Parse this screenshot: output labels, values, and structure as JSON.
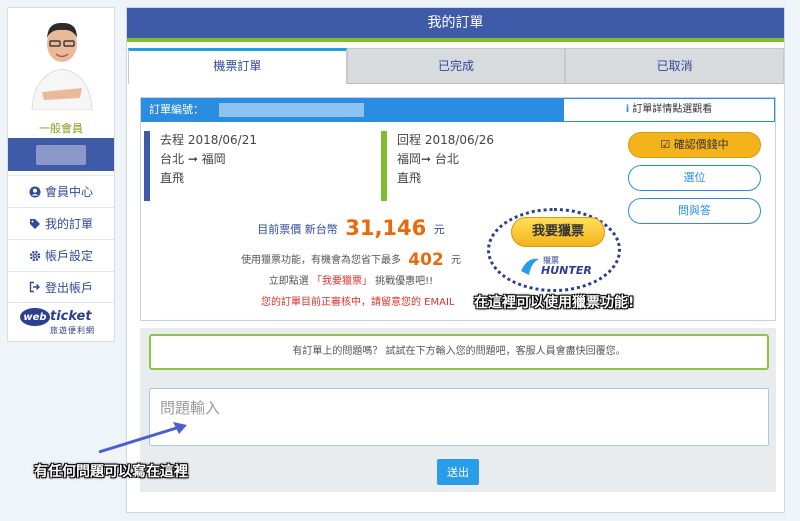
{
  "sidebar": {
    "member_level": "一般會員",
    "menu": [
      {
        "label": "會員中心",
        "icon": "user-circle-icon"
      },
      {
        "label": "我的訂單",
        "icon": "tag-icon"
      },
      {
        "label": "帳戶設定",
        "icon": "gear-icon"
      },
      {
        "label": "登出帳戶",
        "icon": "sign-out-icon"
      }
    ],
    "logo": {
      "web": "web",
      "ticket": "ticket",
      "sub": "旅遊便利網"
    }
  },
  "page": {
    "title": "我的訂單"
  },
  "tabs": [
    "機票訂單",
    "已完成",
    "已取消"
  ],
  "order": {
    "number_label": "訂單編號：",
    "detail_link_icon": "i",
    "detail_link_text": "訂單詳情",
    "detail_link_suffix": "點選觀看",
    "outbound": {
      "date": "去程 2018/06/21",
      "route": "台北 ➞ 福岡",
      "type": "直飛"
    },
    "return": {
      "date": "回程 2018/06/26",
      "route": "福岡➞ 台北",
      "type": "直飛"
    },
    "buttons": {
      "confirm": "確認價錢中",
      "seat": "選位",
      "qa": "問與答"
    },
    "price_prefix": "目前票價 新台幣",
    "price": "31,146",
    "price_unit": "元",
    "hunt_prefix": "使用獵票功能，有機會為您省下最多",
    "hunt_amount": "402",
    "hunt_unit": "元",
    "click_prefix": "立即點選",
    "click_hunt": "「我要獵票」",
    "click_suffix": "挑戰優惠吧!!",
    "review_notice": "您的訂單目前正審核中，請留意您的 EMAIL",
    "hunt_button": "我要獵票",
    "hunter_logo_sub": "獵票",
    "hunter_logo_main": "HUNTER"
  },
  "annotations": {
    "hunt": "在這裡可以使用獵票功能!",
    "question": "有任何問題可以寫在這裡"
  },
  "qa": {
    "notice": "有訂單上的問題嗎？ 試試在下方輸入您的問題吧，客服人員會盡快回覆您。",
    "placeholder": "問題輸入",
    "send": "送出"
  },
  "colors": {
    "brand": "#3f5aa8",
    "accent_green": "#7dbe2c",
    "accent_blue": "#2a8de0",
    "price_orange": "#e96a0c"
  }
}
